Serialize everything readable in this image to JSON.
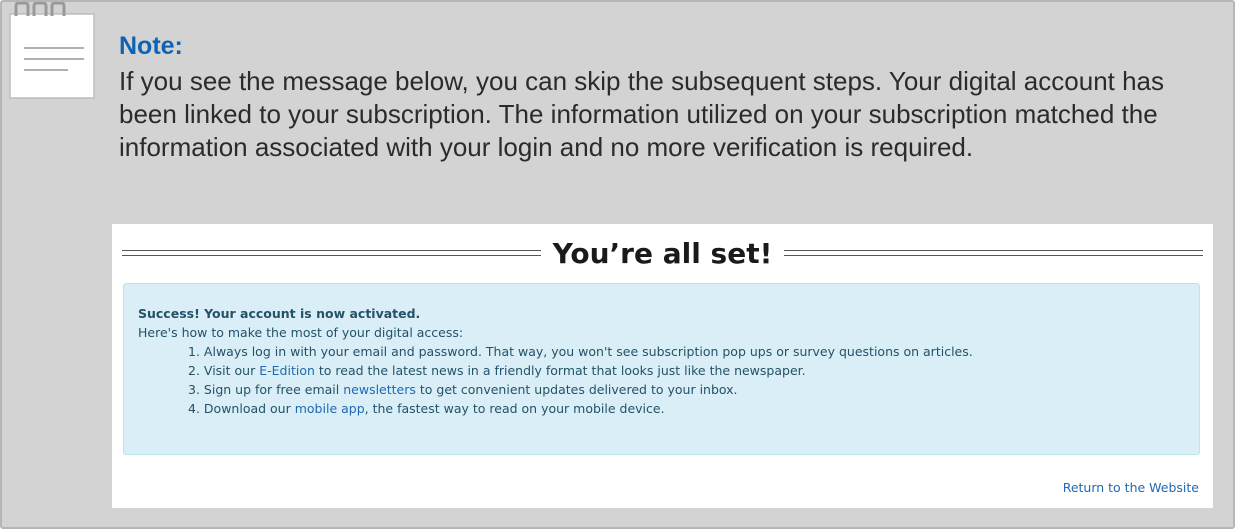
{
  "note": {
    "title": "Note:",
    "text": "If you see the message below, you can skip the subsequent steps. Your digital account has been linked to your subscription. The information utilized on your subscription matched the information associated with your login and no more verification is required."
  },
  "panel": {
    "heading": "You’re all set!",
    "success_title": "Success! Your account is now activated.",
    "intro": "Here's how to make the most of your digital access:",
    "steps": [
      {
        "number": "1.",
        "before": "Always log in with your email and password. That way, you won't see subscription pop ups or survey questions on articles.",
        "link": "",
        "after": ""
      },
      {
        "number": "2.",
        "before": "Visit our",
        "link": "E-Edition",
        "after": "to read the latest news in a friendly format that looks just like the newspaper."
      },
      {
        "number": "3.",
        "before": "Sign up for free email",
        "link": "newsletters",
        "after": "to get convenient updates delivered to your inbox."
      },
      {
        "number": "4.",
        "before": "Download our",
        "link": "mobile app",
        "after": ", the fastest way to read on your mobile device."
      }
    ],
    "return_link": "Return to the Website"
  },
  "colors": {
    "note_background": "#d3d3d3",
    "note_title": "#0e63b3",
    "success_background": "#d9eef6",
    "success_text": "#245269",
    "link": "#1f6ab2"
  },
  "icons": {
    "note": "notepad-icon"
  }
}
